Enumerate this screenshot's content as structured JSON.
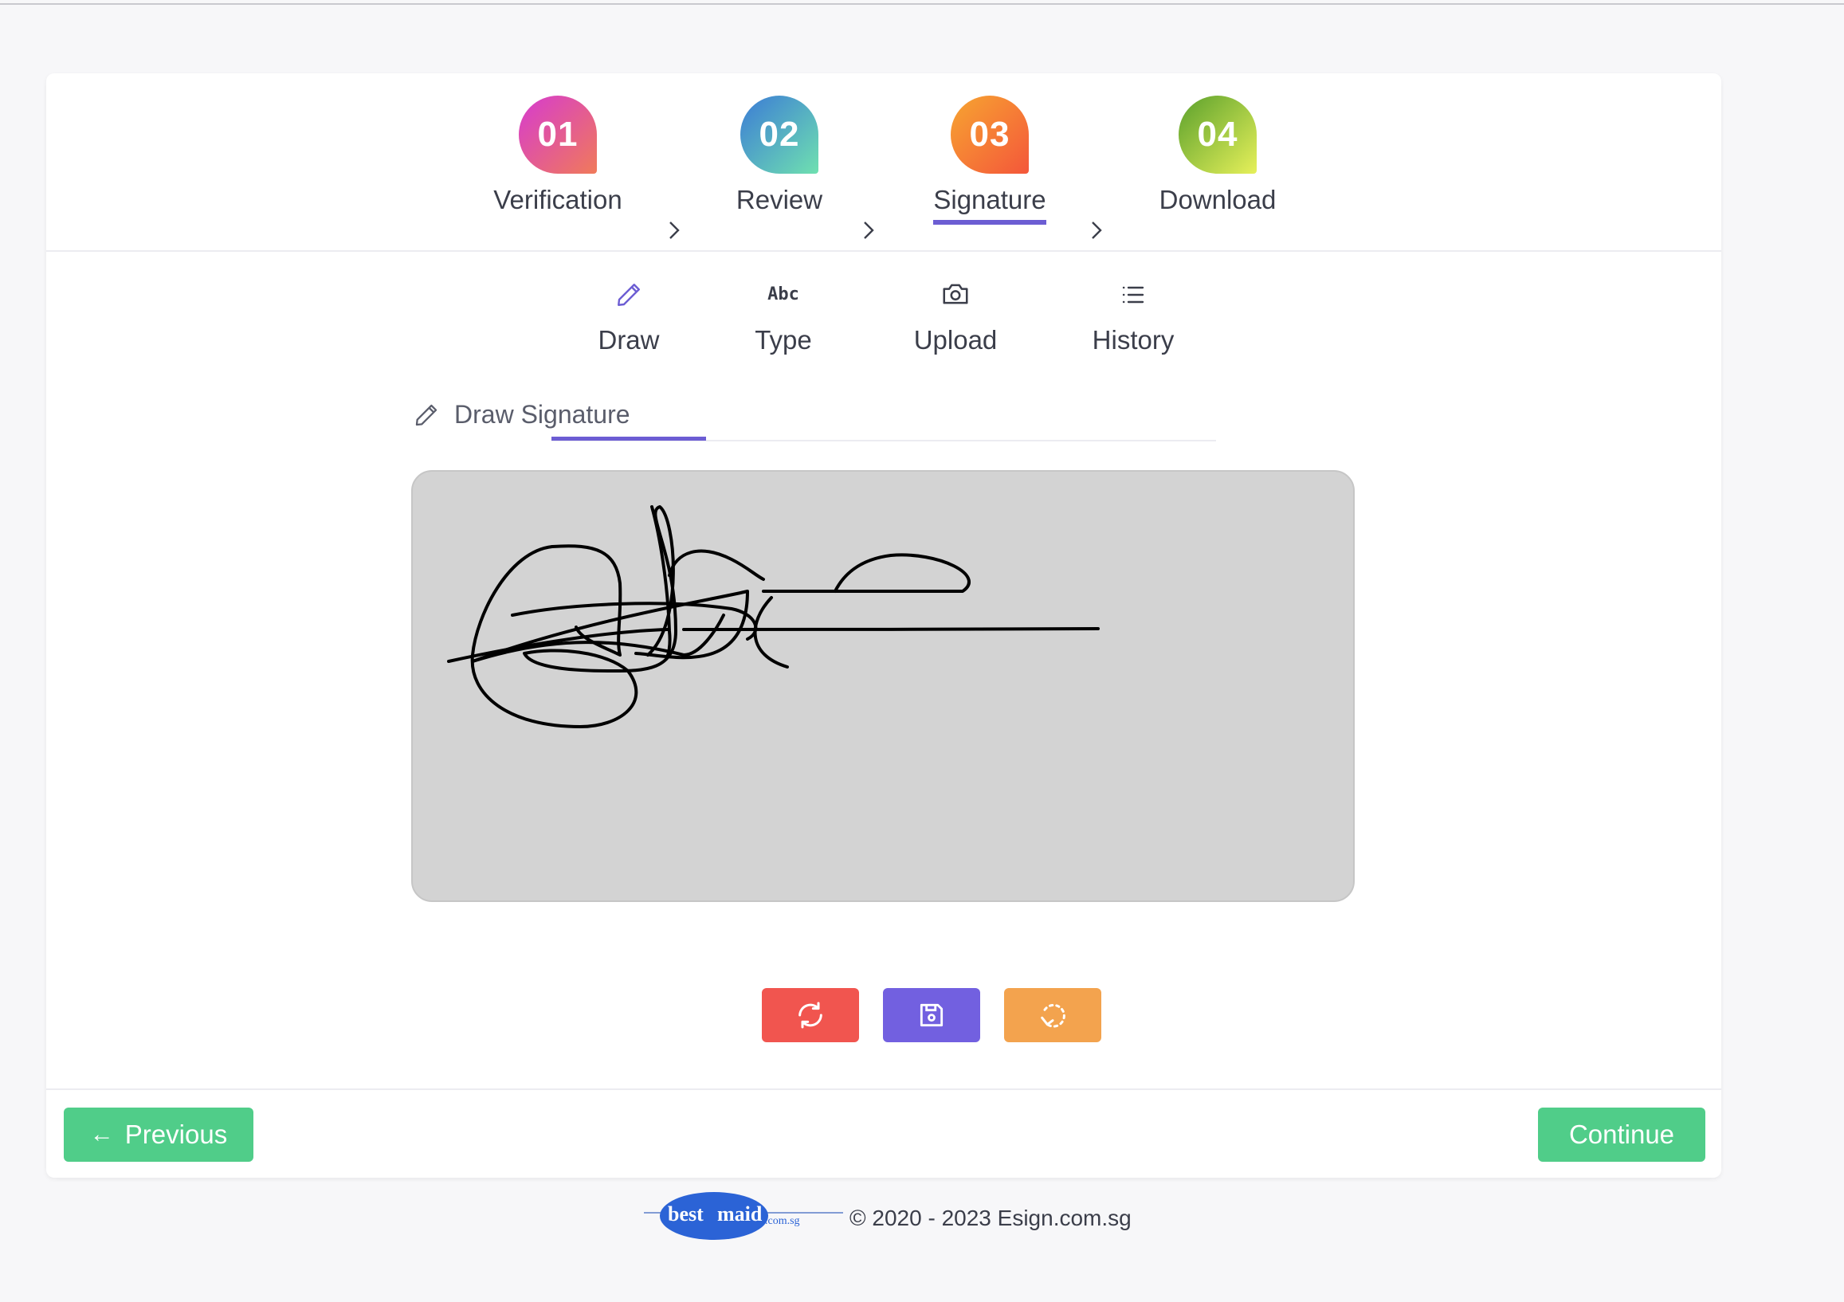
{
  "stepper": {
    "steps": [
      {
        "number": "01",
        "label": "Verification",
        "color_from": "#d63bd0",
        "color_to": "#f07a5a"
      },
      {
        "number": "02",
        "label": "Review",
        "color_from": "#3b7bd6",
        "color_to": "#6fe0b0"
      },
      {
        "number": "03",
        "label": "Signature",
        "color_from": "#f7a531",
        "color_to": "#f4573a",
        "active": true
      },
      {
        "number": "04",
        "label": "Download",
        "color_from": "#5aa02c",
        "color_to": "#e6f05a"
      }
    ]
  },
  "tabs": [
    {
      "label": "Draw",
      "icon": "pencil-icon",
      "active": true
    },
    {
      "label": "Type",
      "icon": "abc-icon",
      "glyph": "Abc"
    },
    {
      "label": "Upload",
      "icon": "camera-icon"
    },
    {
      "label": "History",
      "icon": "list-icon"
    }
  ],
  "draw": {
    "title": "Draw Signature"
  },
  "actions": {
    "reset_color": "#f1554f",
    "save_color": "#7260e0",
    "undo_color": "#f3a34e"
  },
  "nav": {
    "previous_label": "Previous",
    "previous_arrow": "←",
    "continue_label": "Continue"
  },
  "footer": {
    "logo": {
      "brand_a": "best",
      "brand_b": "maid",
      "suffix": ".com.sg"
    },
    "copyright": "© 2020 - 2023 Esign.com.sg"
  },
  "colors": {
    "accent": "#6c5dd3",
    "success": "#50cd89",
    "pad_bg": "#d3d3d3"
  }
}
